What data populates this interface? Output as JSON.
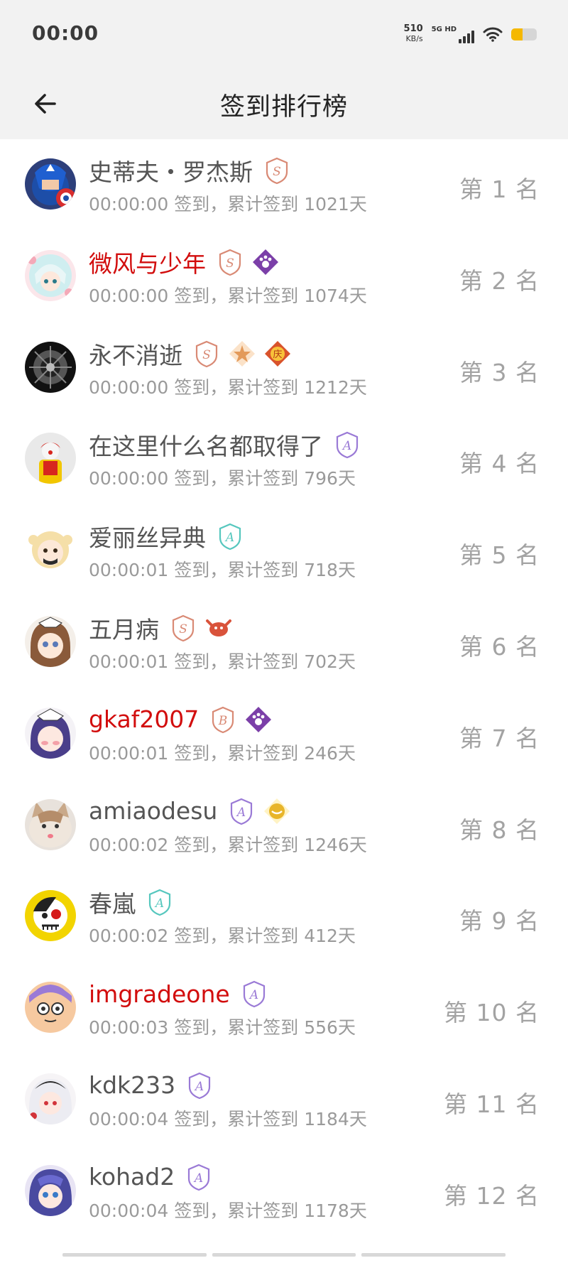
{
  "status_bar": {
    "time": "00:00",
    "net_speed": "510",
    "net_speed_unit": "KB/s",
    "network_label": "5G HD",
    "battery_color": "#f5b800"
  },
  "app_bar": {
    "title": "签到排行榜",
    "back_icon": "arrow-left-icon"
  },
  "colors": {
    "vip_name": "#d20d0d",
    "normal_name": "#555555",
    "meta": "#9a9a9a",
    "rank": "#a3a3a3"
  },
  "rankings": [
    {
      "name": "史蒂夫・罗杰斯",
      "vip": false,
      "time": "00:00:00",
      "days": "1021",
      "rank": "1",
      "badges": [
        {
          "icon": "badge-s-icon",
          "color": "#d98a75"
        }
      ]
    },
    {
      "name": "微风与少年",
      "vip": true,
      "time": "00:00:00",
      "days": "1074",
      "rank": "2",
      "badges": [
        {
          "icon": "badge-s-icon",
          "color": "#d98a75"
        },
        {
          "icon": "badge-paw-icon",
          "color": "#7b3fa8"
        }
      ]
    },
    {
      "name": "永不消逝",
      "vip": false,
      "time": "00:00:00",
      "days": "1212",
      "rank": "3",
      "badges": [
        {
          "icon": "badge-s-icon",
          "color": "#d98a75"
        },
        {
          "icon": "badge-star-icon",
          "color": "#e39a5a"
        },
        {
          "icon": "badge-celebrate-icon",
          "color": "#d9532b"
        }
      ]
    },
    {
      "name": "在这里什么名都取得了",
      "vip": false,
      "time": "00:00:00",
      "days": "796",
      "rank": "4",
      "badges": [
        {
          "icon": "badge-a-icon",
          "color": "#9a7ad6"
        }
      ]
    },
    {
      "name": "爱丽丝异典",
      "vip": false,
      "time": "00:00:01",
      "days": "718",
      "rank": "5",
      "badges": [
        {
          "icon": "badge-a-icon",
          "color": "#56c7be"
        }
      ]
    },
    {
      "name": "五月病",
      "vip": false,
      "time": "00:00:01",
      "days": "702",
      "rank": "6",
      "badges": [
        {
          "icon": "badge-s-icon",
          "color": "#d98a75"
        },
        {
          "icon": "badge-crab-icon",
          "color": "#d9533b"
        }
      ]
    },
    {
      "name": "gkaf2007",
      "vip": true,
      "time": "00:00:01",
      "days": "246",
      "rank": "7",
      "badges": [
        {
          "icon": "badge-b-icon",
          "color": "#d98a75"
        },
        {
          "icon": "badge-paw-icon",
          "color": "#7b3fa8"
        }
      ]
    },
    {
      "name": "amiaodesu",
      "vip": false,
      "time": "00:00:02",
      "days": "1246",
      "rank": "8",
      "badges": [
        {
          "icon": "badge-a-icon",
          "color": "#9a7ad6"
        },
        {
          "icon": "badge-sun-icon",
          "color": "#e8b52a"
        }
      ]
    },
    {
      "name": "春嵐",
      "vip": false,
      "time": "00:00:02",
      "days": "412",
      "rank": "9",
      "badges": [
        {
          "icon": "badge-a-icon",
          "color": "#56c7be"
        }
      ]
    },
    {
      "name": "imgradeone",
      "vip": true,
      "time": "00:00:03",
      "days": "556",
      "rank": "10",
      "badges": [
        {
          "icon": "badge-a-icon",
          "color": "#9a7ad6"
        }
      ]
    },
    {
      "name": "kdk233",
      "vip": false,
      "time": "00:00:04",
      "days": "1184",
      "rank": "11",
      "badges": [
        {
          "icon": "badge-a-icon",
          "color": "#9a7ad6"
        }
      ]
    },
    {
      "name": "kohad2",
      "vip": false,
      "time": "00:00:04",
      "days": "1178",
      "rank": "12",
      "badges": [
        {
          "icon": "badge-a-icon",
          "color": "#9a7ad6"
        }
      ]
    }
  ],
  "labels": {
    "signed_in": "签到，",
    "total": "累计签到",
    "days_unit": "天",
    "rank_prefix": "第",
    "rank_suffix": "名"
  }
}
